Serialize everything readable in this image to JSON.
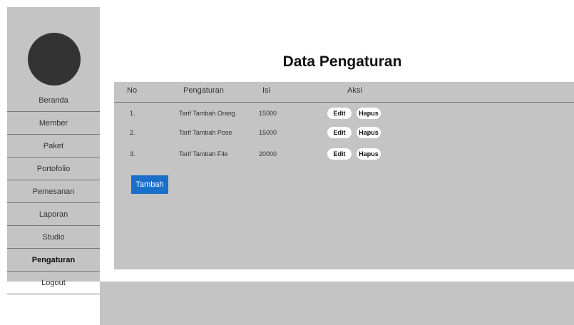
{
  "sidebar": {
    "items": [
      {
        "label": "Beranda"
      },
      {
        "label": "Member"
      },
      {
        "label": "Paket"
      },
      {
        "label": "Portofolio"
      },
      {
        "label": "Pemesanan"
      },
      {
        "label": "Laporan"
      },
      {
        "label": "Studio"
      },
      {
        "label": "Pengaturan",
        "active": true
      },
      {
        "label": "Logout"
      }
    ]
  },
  "header": {
    "title": "Data Pengaturan"
  },
  "table": {
    "columns": {
      "no": "No",
      "pengaturan": "Pengaturan",
      "isi": "Isi",
      "aksi": "Aksi"
    },
    "rows": [
      {
        "no": "1.",
        "pengaturan": "Tarif Tambah Orang",
        "isi": "15000"
      },
      {
        "no": "2.",
        "pengaturan": "Tarif Tambah Pose",
        "isi": "15000"
      },
      {
        "no": "3.",
        "pengaturan": "Tarif Tambah File",
        "isi": "20000"
      }
    ],
    "actions": {
      "edit": "Edit",
      "hapus": "Hapus"
    }
  },
  "buttons": {
    "add": "Tambah"
  },
  "colors": {
    "panel": "#c4c4c4",
    "accent": "#1a6fc9",
    "avatar": "#333333"
  }
}
